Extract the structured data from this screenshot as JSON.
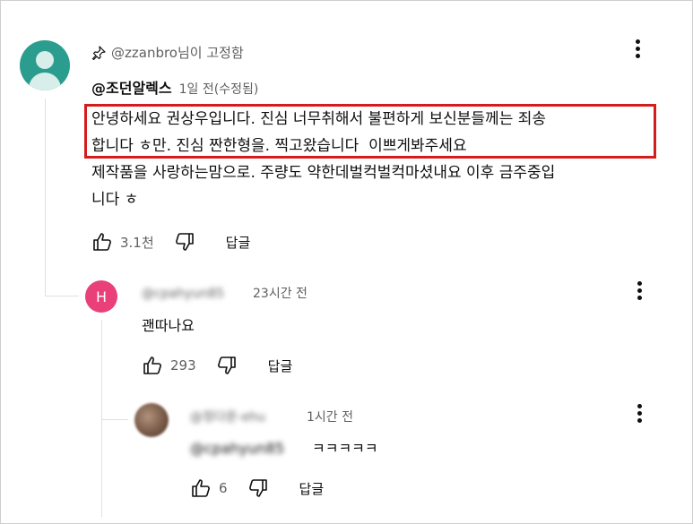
{
  "pinned": {
    "pinned_by": "@zzanbro님이 고정함"
  },
  "main_comment": {
    "author": "@조던알렉스",
    "meta": "1일 전(수정됨)",
    "line1": "안녕하세요 권상우입니다. 진심 너무취해서 불편하게 보신분들께는 죄송",
    "line2": "합니다 ㅎ만. 진심 짠한형을. 찍고왔습니다  이쁘게봐주세요",
    "line3": "제작품을 사랑하는맘으로. 주량도 약한데벌컥벌컥마셨내요 이후 금주중입",
    "line4": "니다 ㅎ",
    "likes": "3.1천",
    "reply_label": "답글"
  },
  "reply1": {
    "avatar_letter": "H",
    "author_blurred": "@cpahyun85",
    "meta": "23시간 전",
    "text": "괜따나요",
    "likes": "293",
    "reply_label": "답글"
  },
  "reply2": {
    "author_blurred": "@정다운-ehu",
    "meta": "1시간 전",
    "mention_blurred": "@cpahyun85",
    "text": "ㅋㅋㅋㅋㅋ",
    "likes": "6",
    "reply_label": "답글"
  },
  "colors": {
    "highlight_border": "#d41c1c",
    "main_avatar": "#2a9d8f",
    "reply_avatar": "#e9407a",
    "muted_text": "#606060"
  }
}
